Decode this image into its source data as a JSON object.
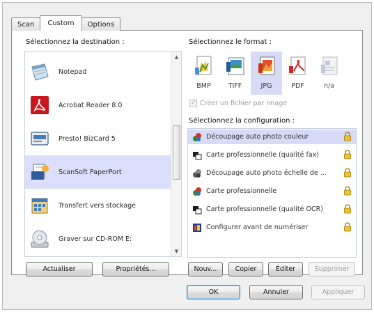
{
  "tabs": [
    {
      "label": "Scan",
      "active": false
    },
    {
      "label": "Custom",
      "active": true
    },
    {
      "label": "Options",
      "active": false
    }
  ],
  "destination": {
    "title": "Sélectionnez la destination :",
    "items": [
      {
        "label": "Notepad",
        "icon": "notepad-icon",
        "selected": false
      },
      {
        "label": "Acrobat Reader 8.0",
        "icon": "acrobat-reader-icon",
        "selected": false
      },
      {
        "label": "Presto! BizCard 5",
        "icon": "bizcard-icon",
        "selected": false
      },
      {
        "label": "ScanSoft PaperPort",
        "icon": "paperport-icon",
        "selected": true
      },
      {
        "label": "Transfert vers stockage",
        "icon": "storage-icon",
        "selected": false
      },
      {
        "label": "Graver sur CD-ROM  E:",
        "icon": "cd-burn-icon",
        "selected": false
      }
    ]
  },
  "format": {
    "title": "Sélectionnez le format :",
    "items": [
      {
        "label": "BMP",
        "icon": "bmp-icon",
        "selected": false
      },
      {
        "label": "TIFF",
        "icon": "tiff-icon",
        "selected": false
      },
      {
        "label": "JPG",
        "icon": "jpg-icon",
        "selected": true
      },
      {
        "label": "PDF",
        "icon": "pdf-icon",
        "selected": false
      },
      {
        "label": "n/a",
        "icon": "na-format-icon",
        "selected": false
      }
    ],
    "checkbox_label": "Créer un fichier par image",
    "checkbox_checked": true,
    "checkbox_enabled": false
  },
  "configuration": {
    "title": "Sélectionnez la configuration :",
    "items": [
      {
        "label": "Découpage auto photo couleur",
        "icon": "color-photo-icon",
        "selected": true
      },
      {
        "label": "Carte professionnelle (qualité fax)",
        "icon": "bw-card-icon",
        "selected": false
      },
      {
        "label": "Découpage auto photo échelle de ...",
        "icon": "gray-photo-icon",
        "selected": false
      },
      {
        "label": "Carte professionnelle",
        "icon": "color-card-icon",
        "selected": false
      },
      {
        "label": "Carte professionnelle (qualité OCR)",
        "icon": "ocr-card-icon",
        "selected": false
      },
      {
        "label": "Configurer avant de numériser",
        "icon": "configure-icon",
        "selected": false
      }
    ]
  },
  "buttons": {
    "refresh": "Actualiser",
    "properties": "Propriétés...",
    "new": "Nouv...",
    "copy": "Copier",
    "edit": "Éditer",
    "delete": "Supprimer",
    "ok": "OK",
    "cancel": "Annuler",
    "apply": "Appliquer"
  },
  "colors": {
    "selection": "#d7dbf8",
    "panel_border": "#8e8f8f",
    "disabled_text": "#a0a0a0"
  }
}
